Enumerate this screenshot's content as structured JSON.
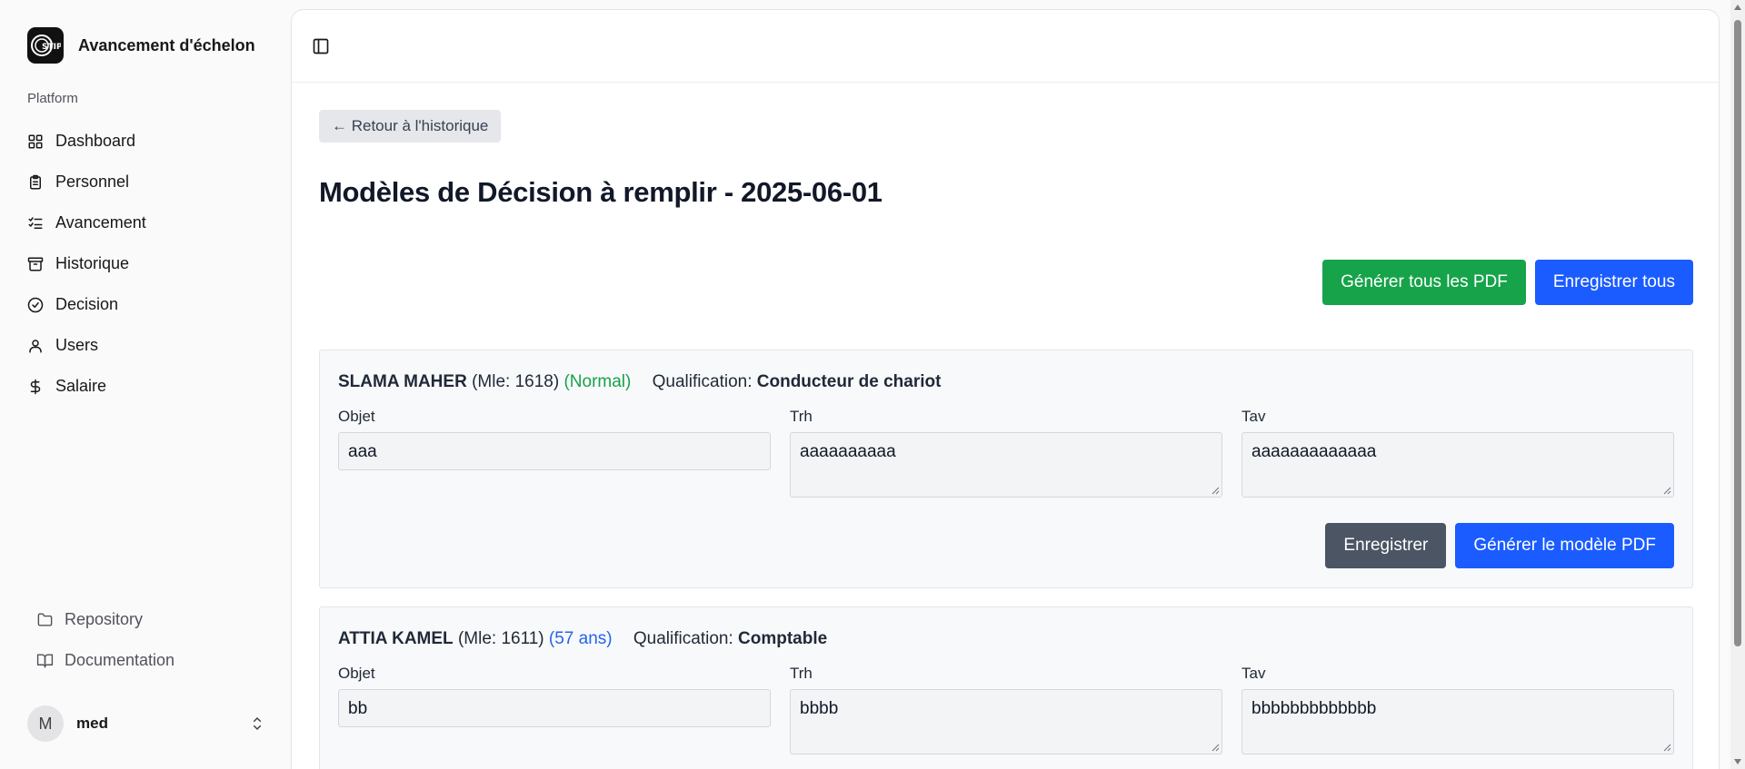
{
  "app": {
    "title": "Avancement d'échelon",
    "logo_text": "STIP"
  },
  "sidebar": {
    "group_label": "Platform",
    "items": [
      {
        "label": "Dashboard",
        "icon": "layout-grid-icon"
      },
      {
        "label": "Personnel",
        "icon": "clipboard-list-icon"
      },
      {
        "label": "Avancement",
        "icon": "list-checks-icon"
      },
      {
        "label": "Historique",
        "icon": "archive-icon"
      },
      {
        "label": "Decision",
        "icon": "check-circle-icon"
      },
      {
        "label": "Users",
        "icon": "user-icon"
      },
      {
        "label": "Salaire",
        "icon": "dollar-icon"
      }
    ],
    "bottom_links": [
      {
        "label": "Repository",
        "icon": "folder-icon"
      },
      {
        "label": "Documentation",
        "icon": "book-icon"
      }
    ],
    "user": {
      "initial": "M",
      "name": "med"
    }
  },
  "page": {
    "back_label": "← Retour à l'historique",
    "title": "Modèles de Décision à remplir - 2025-06-01",
    "generate_all_label": "Générer tous les PDF",
    "save_all_label": "Enregistrer tous"
  },
  "labels": {
    "objet": "Objet",
    "trh": "Trh",
    "tav": "Tav",
    "qualification": "Qualification:",
    "save": "Enregistrer",
    "generate_pdf": "Générer le modèle PDF"
  },
  "employees": [
    {
      "name": "SLAMA MAHER",
      "mle": "(Mle: 1618)",
      "status": "(Normal)",
      "qualification": "Conducteur de chariot",
      "objet": "aaa",
      "trh": "aaaaaaaaaa",
      "tav": "aaaaaaaaaaaaa"
    },
    {
      "name": "ATTIA KAMEL",
      "mle": "(Mle: 1611)",
      "status": "(57 ans)",
      "qualification": "Comptable",
      "objet": "bb",
      "trh": "bbbb",
      "tav": "bbbbbbbbbbbbb"
    }
  ],
  "colors": {
    "green": "#16a34a",
    "blue": "#1a5cff",
    "gray_button": "#4b5563",
    "status_normal": "#16a34a",
    "status_age": "#2563eb"
  }
}
